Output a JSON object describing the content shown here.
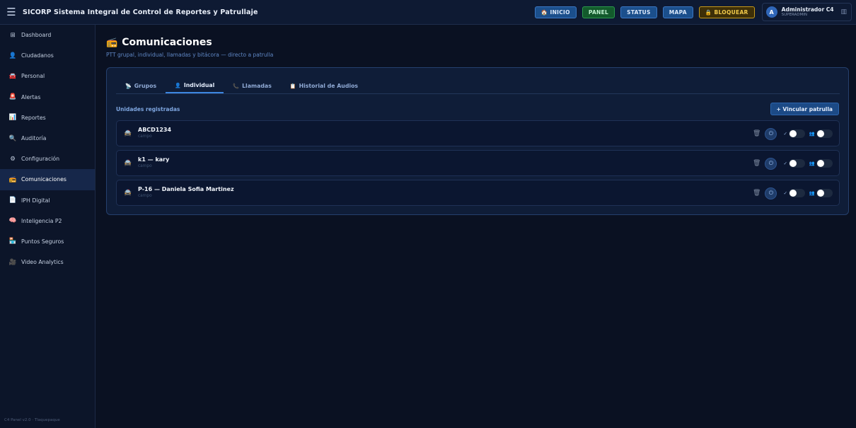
{
  "header": {
    "menu_icon": "hamburger-icon",
    "title": "SICORP Sistema Integral de Control de Reportes y Patrullaje",
    "buttons": [
      {
        "label": "INICIO",
        "icon": "🏠",
        "variant": "blue"
      },
      {
        "label": "PANEL",
        "icon": "",
        "variant": "green"
      },
      {
        "label": "STATUS",
        "icon": "",
        "variant": "blue"
      },
      {
        "label": "MAPA",
        "icon": "",
        "variant": "blue"
      },
      {
        "label": "BLOQUEAR",
        "icon": "🔒",
        "variant": "yellow"
      }
    ],
    "user": {
      "initial": "A",
      "name": "Administrador C4",
      "role": "SUPERADMIN"
    }
  },
  "sidebar": {
    "items": [
      {
        "label": "Dashboard",
        "icon": "⊞",
        "name": "dashboard"
      },
      {
        "label": "Ciudadanos",
        "icon": "👤",
        "name": "ciudadanos"
      },
      {
        "label": "Personal",
        "icon": "🚘",
        "name": "personal"
      },
      {
        "label": "Alertas",
        "icon": "🚨",
        "name": "alertas"
      },
      {
        "label": "Reportes",
        "icon": "📊",
        "name": "reportes"
      },
      {
        "label": "Auditoría",
        "icon": "🔍",
        "name": "auditoria"
      },
      {
        "label": "Configuración",
        "icon": "⚙",
        "name": "configuracion"
      },
      {
        "label": "Comunicaciones",
        "icon": "📻",
        "name": "comunicaciones",
        "active": true
      },
      {
        "label": "IPH Digital",
        "icon": "📄",
        "name": "iph-digital"
      },
      {
        "label": "Inteligencia P2",
        "icon": "🧠",
        "name": "inteligencia-p2"
      },
      {
        "label": "Puntos Seguros",
        "icon": "🏪",
        "name": "puntos-seguros"
      },
      {
        "label": "Video Analytics",
        "icon": "🎥",
        "name": "video-analytics"
      }
    ],
    "footer": "C4 Panel v2.0 · Tlaquepaque"
  },
  "page": {
    "icon": "📻",
    "title": "Comunicaciones",
    "subtitle": "PTT grupal, individual, llamadas y bitácora — directo a patrulla"
  },
  "tabs": [
    {
      "label": "Grupos",
      "icon": "📡",
      "active": false
    },
    {
      "label": "Individual",
      "icon": "👤",
      "active": true
    },
    {
      "label": "Llamadas",
      "icon": "📞",
      "active": false
    },
    {
      "label": "Historial de Audios",
      "icon": "📋",
      "active": false
    }
  ],
  "units_section": {
    "label": "Unidades registradas",
    "link_button": "+ Vincular patrulla"
  },
  "units": [
    {
      "name": "ABCD1234",
      "type": "campo",
      "icon": "🚔"
    },
    {
      "name": "k1 — kary",
      "type": "campo",
      "icon": "🚔"
    },
    {
      "name": "P-16 — Daniela Sofia Martinez",
      "type": "campo",
      "icon": "🚔"
    }
  ],
  "unit_actions": {
    "delete_icon": "🗑",
    "power_icon": "⏻",
    "toggle1_icon": "✓",
    "toggle2_icon": "👥"
  }
}
